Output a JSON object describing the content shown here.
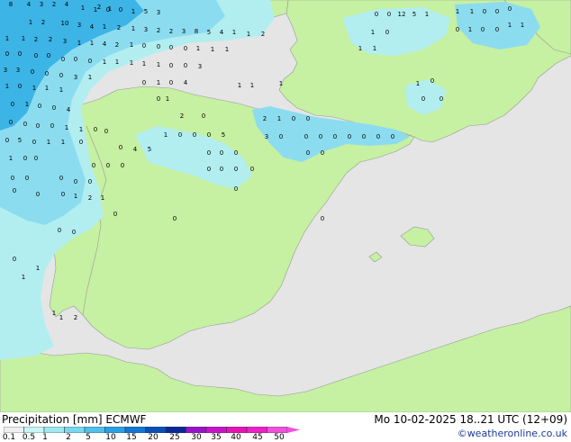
{
  "map": {
    "colors": {
      "sea": "#e5e5e5",
      "land": "#c6f0a2",
      "precip_light": "#b2eef0",
      "precip_medium": "#8cdcf0",
      "precip_heavy": "#3cb4e6",
      "border": "#999999"
    },
    "precip_values": [
      "8",
      "4",
      "3",
      "2",
      "4",
      "1",
      "1",
      "0",
      "0",
      "1",
      "5",
      "3",
      "1",
      "2",
      "10",
      "3",
      "4",
      "1",
      "2",
      "1",
      "3",
      "2",
      "2",
      "3",
      "8",
      "5",
      "4",
      "1",
      "1",
      "2",
      "1",
      "1",
      "2",
      "2",
      "3",
      "1",
      "1",
      "4",
      "2",
      "1",
      "0",
      "0",
      "0",
      "0",
      "1",
      "1",
      "1",
      "0",
      "0",
      "0",
      "0",
      "0",
      "0",
      "0",
      "1",
      "1",
      "1",
      "1",
      "1",
      "0",
      "0",
      "3",
      "3",
      "3",
      "0",
      "0",
      "0",
      "3",
      "1",
      "1",
      "0",
      "1",
      "1",
      "1",
      "0",
      "1",
      "0",
      "4",
      "1",
      "1",
      "1",
      "0",
      "1",
      "0",
      "0",
      "4",
      "0",
      "1",
      "0",
      "0",
      "1",
      "0",
      "0",
      "0",
      "0",
      "0",
      "1",
      "1",
      "0",
      "0",
      "2",
      "0",
      "2",
      "1",
      "0",
      "0",
      "0",
      "5",
      "0",
      "1",
      "1",
      "0",
      "0",
      "4",
      "5",
      "1",
      "0",
      "0",
      "0",
      "5",
      "3",
      "0",
      "0",
      "0",
      "0",
      "0",
      "0",
      "0",
      "0",
      "1",
      "0",
      "0",
      "0",
      "0",
      "0",
      "0",
      "0",
      "0",
      "0",
      "0",
      "0",
      "0",
      "0",
      "0",
      "0",
      "0",
      "0",
      "0",
      "0",
      "0",
      "0",
      "0",
      "1",
      "2",
      "1",
      "0",
      "0",
      "0",
      "0",
      "0",
      "0",
      "0",
      "1",
      "1",
      "1",
      "1",
      "2",
      "2",
      "1",
      "0",
      "0",
      "12",
      "5",
      "1",
      "1",
      "1",
      "0",
      "0",
      "0",
      "1",
      "0",
      "0",
      "1",
      "0",
      "0",
      "1",
      "1",
      "1",
      "1"
    ]
  },
  "footer": {
    "title_left": "Precipitation [mm]  ECMWF",
    "title_right": "Mo 10-02-2025 18..21 UTC (12+09)",
    "credit": "©weatheronline.co.uk"
  },
  "legend": {
    "ticks": [
      "0.1",
      "0.5",
      "1",
      "2",
      "5",
      "10",
      "15",
      "20",
      "25",
      "30",
      "35",
      "40",
      "45",
      "50"
    ],
    "colors": [
      "#f0f0f0",
      "#c8f5f5",
      "#a0e8f0",
      "#78d8f0",
      "#50c0ec",
      "#28a0e4",
      "#1478d2",
      "#0a50b4",
      "#0a2896",
      "#9614c8",
      "#c814c8",
      "#e614b4",
      "#f01ec8",
      "#f050dc"
    ]
  }
}
